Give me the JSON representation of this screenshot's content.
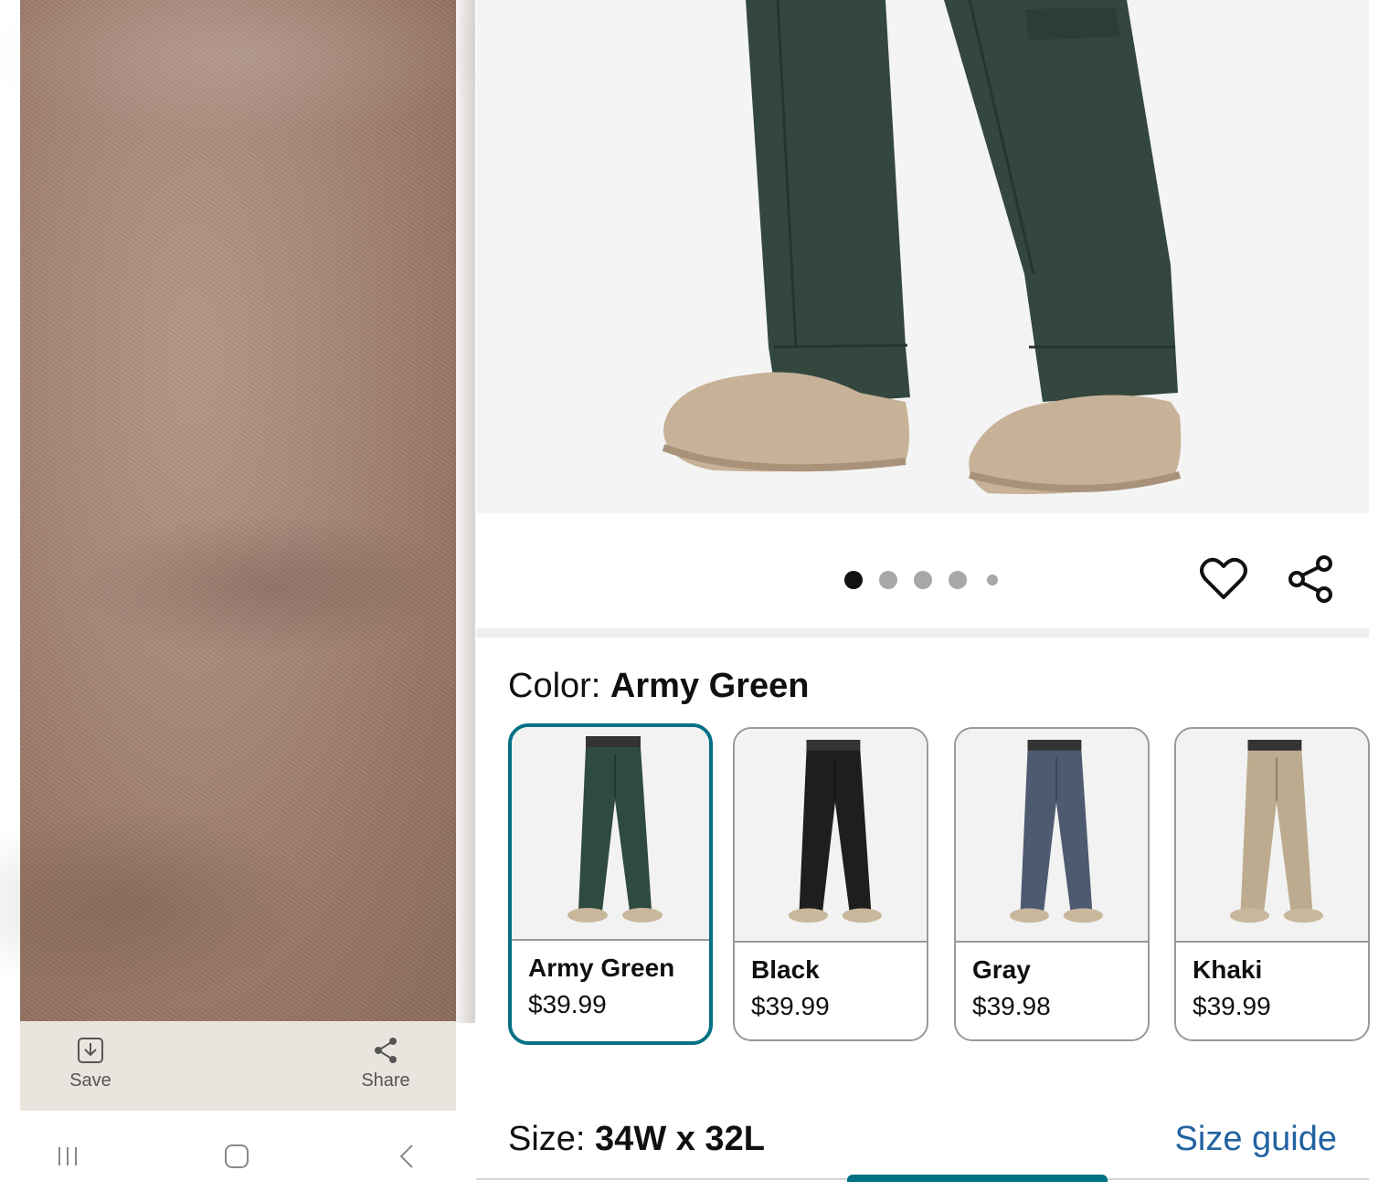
{
  "gallery": {
    "actions": {
      "save_label": "Save",
      "share_label": "Share"
    }
  },
  "product": {
    "image_carousel": {
      "total_dots": 5,
      "active_index": 0
    },
    "color": {
      "label": "Color: ",
      "selected": "Army Green"
    },
    "swatches": [
      {
        "name": "Army Green",
        "price": "$39.99",
        "pants_color": "#2f4a3f",
        "selected": true
      },
      {
        "name": "Black",
        "price": "$39.99",
        "pants_color": "#1e1e1e",
        "selected": false
      },
      {
        "name": "Gray",
        "price": "$39.98",
        "pants_color": "#4d5a70",
        "selected": false
      },
      {
        "name": "Khaki",
        "price": "$39.99",
        "pants_color": "#bcab8e",
        "selected": false
      }
    ],
    "size": {
      "label": "Size: ",
      "selected": "34W x 32L",
      "guide_label": "Size guide"
    }
  },
  "colors": {
    "accent": "#007185",
    "link": "#2162a1",
    "text": "#0f1111"
  }
}
